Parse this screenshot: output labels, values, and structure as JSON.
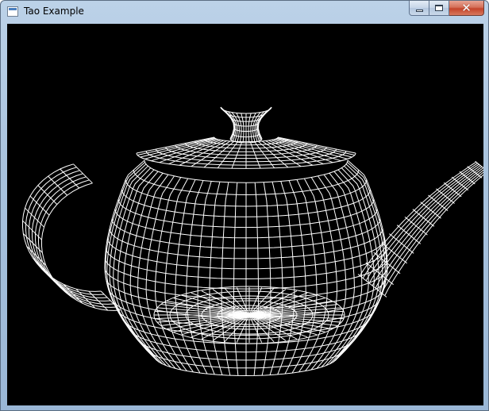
{
  "window": {
    "title": "Tao Example",
    "icon": "app-window-icon",
    "buttons": {
      "minimize": "minimize-icon",
      "maximize": "maximize-icon",
      "close": "close-icon",
      "close_glyph": "✕"
    }
  },
  "viewport": {
    "background": "#000000",
    "wire_color": "#ffffff",
    "content": "teapot-wireframe"
  }
}
